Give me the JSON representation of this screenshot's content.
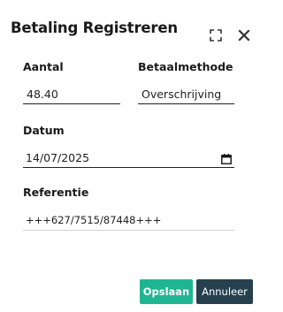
{
  "dialog": {
    "title": "Betaling Registreren"
  },
  "fields": {
    "aantal": {
      "label": "Aantal",
      "value": "48.40"
    },
    "betaalmethode": {
      "label": "Betaalmethode",
      "value": "Overschrijving"
    },
    "datum": {
      "label": "Datum",
      "value": "14/07/2025"
    },
    "referentie": {
      "label": "Referentie",
      "value": "+++627/7515/87448+++"
    }
  },
  "actions": {
    "save_label": "Opslaan",
    "cancel_label": "Annuleer"
  },
  "colors": {
    "save": "#1fb592",
    "cancel": "#26404e"
  },
  "icons": {
    "maximize": "maximize-icon",
    "close": "close-icon",
    "calendar": "calendar-icon"
  }
}
